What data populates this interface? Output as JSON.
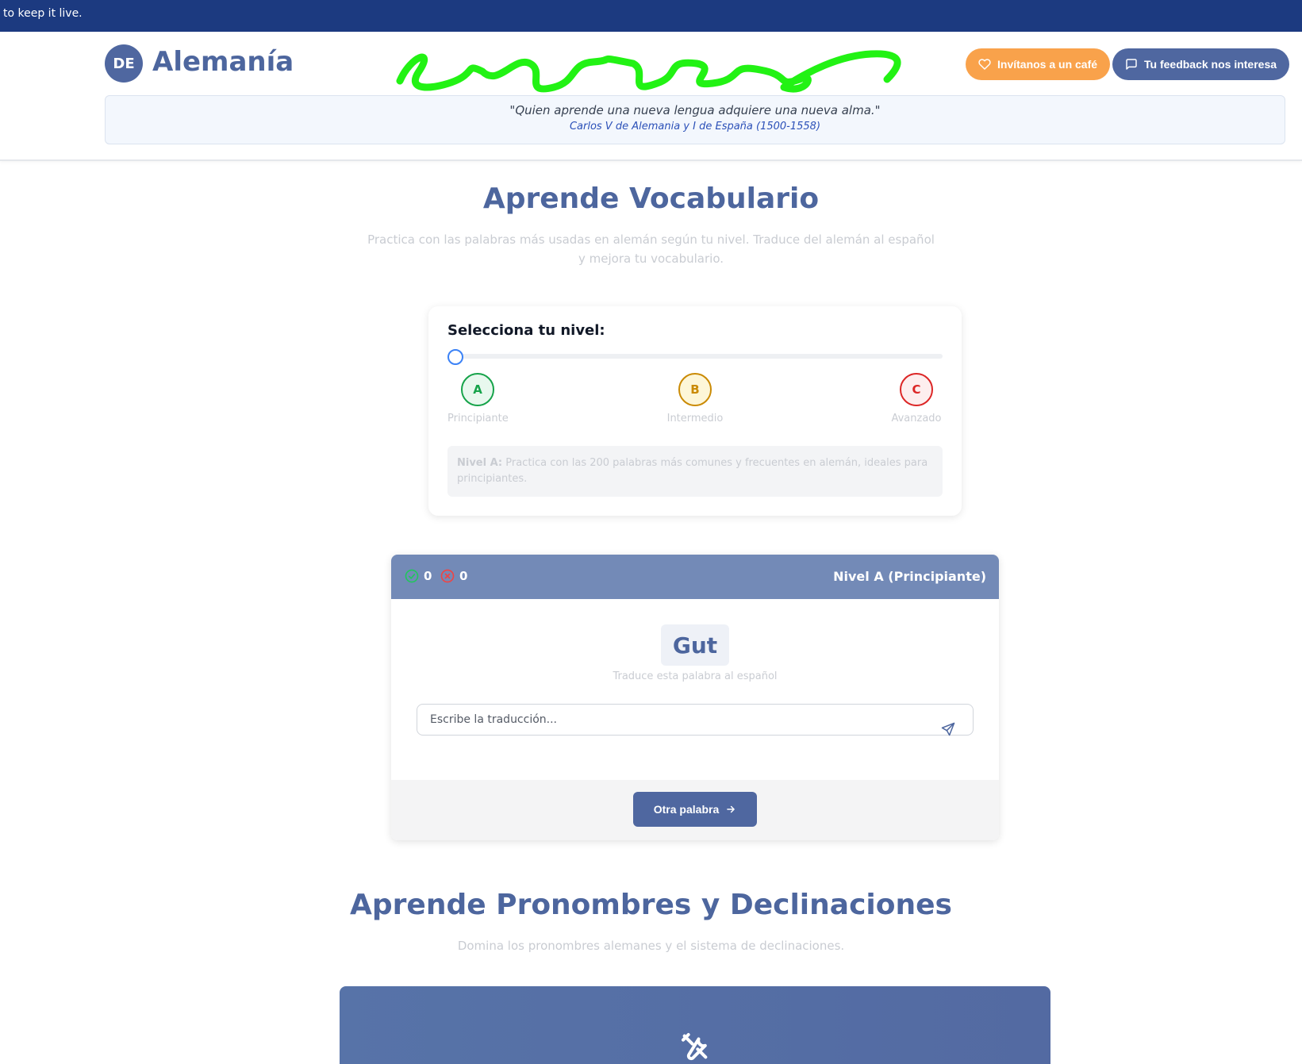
{
  "topbar": {
    "text": "to keep it live."
  },
  "header": {
    "logo_badge": "DE",
    "logo_text": "Alemanía",
    "cafe_button": "Invítanos a un café",
    "feedback_button": "Tu feedback nos interesa",
    "quote": "\"Quien aprende una nueva lengua adquiere una nueva alma.\"",
    "quote_author": "Carlos V de Alemania y I de España (1500-1558)"
  },
  "vocab_section": {
    "title": "Aprende Vocabulario",
    "subtitle_line1": "Practica con las palabras más usadas en alemán según tu nivel. Traduce del alemán al español",
    "subtitle_line2": "y mejora tu vocabulario."
  },
  "level_selector": {
    "label": "Selecciona tu nivel:",
    "slider_value": 0,
    "levels": [
      {
        "letter": "A",
        "name": "Principiante",
        "color": "#16a34a"
      },
      {
        "letter": "B",
        "name": "Intermedio",
        "color": "#ca8a04"
      },
      {
        "letter": "C",
        "name": "Avanzado",
        "color": "#dc2626"
      }
    ],
    "description_label": "Nivel A:",
    "description_text": " Practica con las 200 palabras más comunes y frecuentes en alemán, ideales para principiantes."
  },
  "vocab_card": {
    "correct_count": "0",
    "wrong_count": "0",
    "level_label": "Nivel A (Principiante)",
    "word": "Gut",
    "hint": "Traduce esta palabra al español",
    "input_placeholder": "Escribe la traducción...",
    "next_button": "Otra palabra"
  },
  "pronouns_section": {
    "title": "Aprende Pronombres y Declinaciones",
    "subtitle": "Domina los pronombres alemanes y el sistema de declinaciones."
  },
  "colors": {
    "brand": "#4f67a0",
    "topbar": "#1c3a80",
    "cafe": "#f9a24b",
    "card_header": "#738ab7"
  }
}
